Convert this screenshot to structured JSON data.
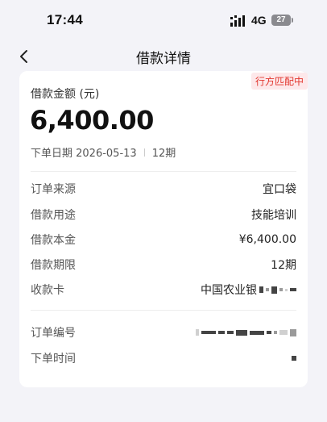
{
  "status_bar": {
    "time": "17:44",
    "network": "4G",
    "battery": "27"
  },
  "nav": {
    "title": "借款详情"
  },
  "loan": {
    "badge": "行方匹配中",
    "amount_label": "借款金额 (元)",
    "amount": "6,400.00",
    "order_date": "下单日期 2026-05-13",
    "term_short": "12期"
  },
  "details": [
    {
      "label": "订单来源",
      "value": "宜口袋"
    },
    {
      "label": "借款用途",
      "value": "技能培训"
    },
    {
      "label": "借款本金",
      "value": "¥6,400.00"
    },
    {
      "label": "借款期限",
      "value": "12期"
    },
    {
      "label": "收款卡",
      "value": "中国农业银"
    }
  ],
  "order": [
    {
      "label": "订单编号",
      "value": ""
    },
    {
      "label": "下单时间",
      "value": ""
    }
  ],
  "colors": {
    "badge_bg": "#fde8ea",
    "badge_text": "#e2372f",
    "page_bg": "#f3f3f8"
  }
}
